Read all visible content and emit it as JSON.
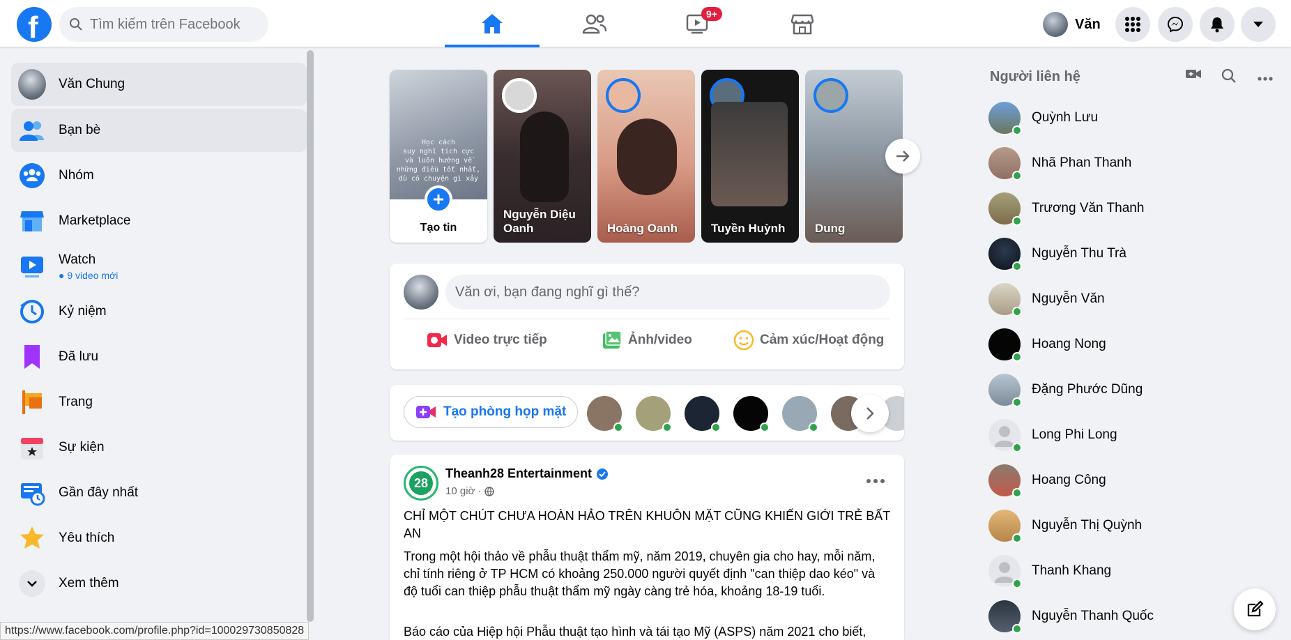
{
  "topbar": {
    "search_placeholder": "Tìm kiếm trên Facebook",
    "watch_badge": "9+",
    "profile_name": "Văn"
  },
  "sidebar": {
    "items": [
      {
        "label": "Văn Chung",
        "icon": "profile-avatar"
      },
      {
        "label": "Bạn bè",
        "icon": "friends-icon"
      },
      {
        "label": "Nhóm",
        "icon": "groups-icon"
      },
      {
        "label": "Marketplace",
        "icon": "marketplace-icon"
      },
      {
        "label": "Watch",
        "sub": "9 video mới",
        "icon": "watch-icon"
      },
      {
        "label": "Kỷ niệm",
        "icon": "memories-icon"
      },
      {
        "label": "Đã lưu",
        "icon": "saved-icon"
      },
      {
        "label": "Trang",
        "icon": "pages-icon"
      },
      {
        "label": "Sự kiện",
        "icon": "events-icon"
      },
      {
        "label": "Gần đây nhất",
        "icon": "most-recent-icon"
      },
      {
        "label": "Yêu thích",
        "icon": "favorites-icon"
      },
      {
        "label": "Xem thêm",
        "icon": "chevron-down-icon"
      }
    ],
    "status_url": "https://www.facebook.com/profile.php?id=100029730850828"
  },
  "stories": {
    "create_label": "Tạo tin",
    "create_text": "Học cách\nsuy nghĩ tích cực\nvà luôn hướng về\nnhững điều tốt nhất,\ndù có chuyện gì xảy ra",
    "items": [
      {
        "name": "Nguyễn Diệu\nOanh"
      },
      {
        "name": "Hoàng Oanh"
      },
      {
        "name": "Tuyền Huỳnh"
      },
      {
        "name": "Dung"
      }
    ]
  },
  "composer": {
    "placeholder": "Văn ơi, bạn đang nghĩ gì thế?",
    "actions": [
      "Video trực tiếp",
      "Ảnh/video",
      "Cảm xúc/Hoạt động"
    ]
  },
  "rooms": {
    "button_label": "Tạo phòng họp mặt"
  },
  "post": {
    "author": "Theanh28 Entertainment",
    "time": "10 giờ ·",
    "headline": "CHỈ MỘT CHÚT CHƯA HOÀN HẢO TRÊN KHUÔN MẶT CŨNG KHIẾN GIỚI TRẺ BẤT AN",
    "paragraph1": "Trong một hội thảo về phẫu thuật thẩm mỹ, năm 2019, chuyên gia cho hay, mỗi năm, chỉ tính riêng ở TP HCM có khoảng 250.000 người quyết định \"can thiệp dao kéo\" và độ tuổi can thiệp phẫu thuật thẩm mỹ ngày càng trẻ hóa, khoảng 18-19 tuổi.",
    "paragraph2": "Báo cáo của Hiệp hội Phẫu thuật tạo hình và tái tạo Mỹ (ASPS) năm 2021 cho biết,"
  },
  "contacts": {
    "title": "Người liên hệ",
    "items": [
      "Quỳnh Lưu",
      "Nhã Phan Thanh",
      "Trương Văn Thanh",
      "Nguyễn Thu Trà",
      "Nguyễn Văn",
      "Hoang Nong",
      "Đặng Phước Dũng",
      "Long Phi Long",
      "Hoang Công",
      "Nguyễn Thị Quỳnh",
      "Thanh Khang",
      "Nguyễn Thanh Quốc"
    ]
  },
  "colors": {
    "brand": "#1877f2",
    "online": "#31a24c",
    "badge": "#e41e3f"
  }
}
